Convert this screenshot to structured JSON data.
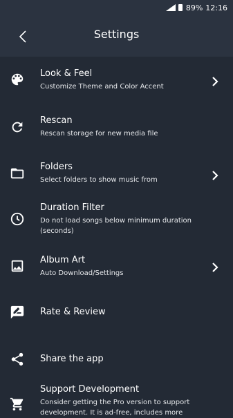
{
  "status": {
    "battery": "89%",
    "time": "12:16"
  },
  "toolbar": {
    "title": "Settings"
  },
  "items": [
    {
      "title": "Look & Feel",
      "subtitle": "Customize Theme and Color Accent",
      "icon": "palette-icon",
      "chevron": true
    },
    {
      "title": "Rescan",
      "subtitle": "Rescan storage for new media file",
      "icon": "refresh-icon",
      "chevron": false
    },
    {
      "title": "Folders",
      "subtitle": "Select folders to show music from",
      "icon": "folder-icon",
      "chevron": true
    },
    {
      "title": "Duration Filter",
      "subtitle": "Do not load songs below minimum duration (seconds)",
      "icon": "clock-icon",
      "chevron": false
    },
    {
      "title": "Album Art",
      "subtitle": "Auto Download/Settings",
      "icon": "image-icon",
      "chevron": true
    },
    {
      "title": "Rate & Review",
      "subtitle": "",
      "icon": "rate-review-icon",
      "chevron": false
    },
    {
      "title": "Share the app",
      "subtitle": "",
      "icon": "share-icon",
      "chevron": false
    },
    {
      "title": "Support Development",
      "subtitle": "Consider getting the Pro version to support development. It is ad-free, includes more",
      "icon": "cart-icon",
      "chevron": false
    }
  ],
  "colors": {
    "background": "#232a35",
    "toolbar": "#2b3340"
  }
}
